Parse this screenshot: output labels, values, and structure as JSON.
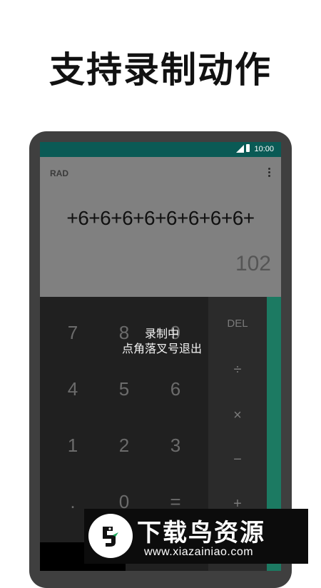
{
  "headline": "支持录制动作",
  "status_bar": {
    "time": "10:00"
  },
  "display": {
    "mode": "RAD",
    "formula": "+6+6+6+6+6+6+6+6+",
    "result": "102"
  },
  "keypad": {
    "digits": [
      "7",
      "8",
      "9",
      "4",
      "5",
      "6",
      "1",
      "2",
      "3",
      ".",
      "0",
      "="
    ],
    "operators": [
      "DEL",
      "÷",
      "×",
      "−",
      "+"
    ]
  },
  "recording_toast": {
    "line1": "录制中",
    "line2": "点角落叉号退出"
  },
  "watermark": {
    "title": "下载鸟资源",
    "url": "www.xiazainiao.com"
  },
  "colors": {
    "status_bar": "#0a5a55",
    "accent": "#1c7a62",
    "display_bg": "#808080",
    "keypad_bg": "#202020"
  }
}
